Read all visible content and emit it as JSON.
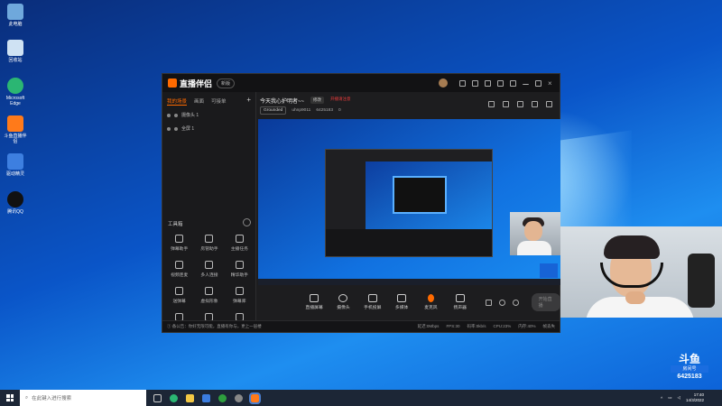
{
  "desktop": {
    "icons": [
      {
        "label": "此电脑",
        "color": "#6fa8dc"
      },
      {
        "label": "回收站",
        "color": "#cfe2f3"
      },
      {
        "label": "Microsoft Edge",
        "color": "#2bb673"
      },
      {
        "label": "斗鱼直播伴侣",
        "color": "#ff7a1a"
      },
      {
        "label": "驱动精灵",
        "color": "#3d7fe0"
      },
      {
        "label": "腾讯QQ",
        "color": "#111111"
      }
    ]
  },
  "app": {
    "brand": "直播伴侣",
    "version": "新版",
    "tabs": [
      "我的场景",
      "画面",
      "可接单"
    ],
    "scenes": [
      "摄像头 1",
      "全屏 1"
    ],
    "toolbox_title": "工具箱",
    "tools": [
      "弹幕助手",
      "房管助手",
      "主播任务",
      "视频连麦",
      "多人连接",
      "精华助手",
      "送弹幕",
      "虚拟形象",
      "弹幕库",
      "提示",
      "",
      ""
    ],
    "room_title": "今天我心护明者~~",
    "edit_tag": "修改",
    "warning": "开播请注意",
    "category": "Grounded",
    "user_id": "uhnp9011",
    "room_id": "6425183",
    "fans": "0",
    "controls": [
      "直播屏幕",
      "摄像头",
      "手机投屏",
      "多媒体",
      "麦克风",
      "扬声器"
    ],
    "start_button": "开始直播",
    "notice": "① 备公告：你好无限可能，直播有你与，更上一层楼",
    "stats": [
      "延迟:0Mbps",
      "FPS:30",
      "码率:0kb/s",
      "CPU:23%",
      "内存:40%",
      "帧丢失"
    ]
  },
  "overlay": {
    "logo": "斗鱼",
    "room_label": "房间号",
    "room_number": "6425183"
  },
  "taskbar": {
    "search_placeholder": "在此键入进行搜索",
    "time": "17:40",
    "date": "14/3/2022"
  }
}
